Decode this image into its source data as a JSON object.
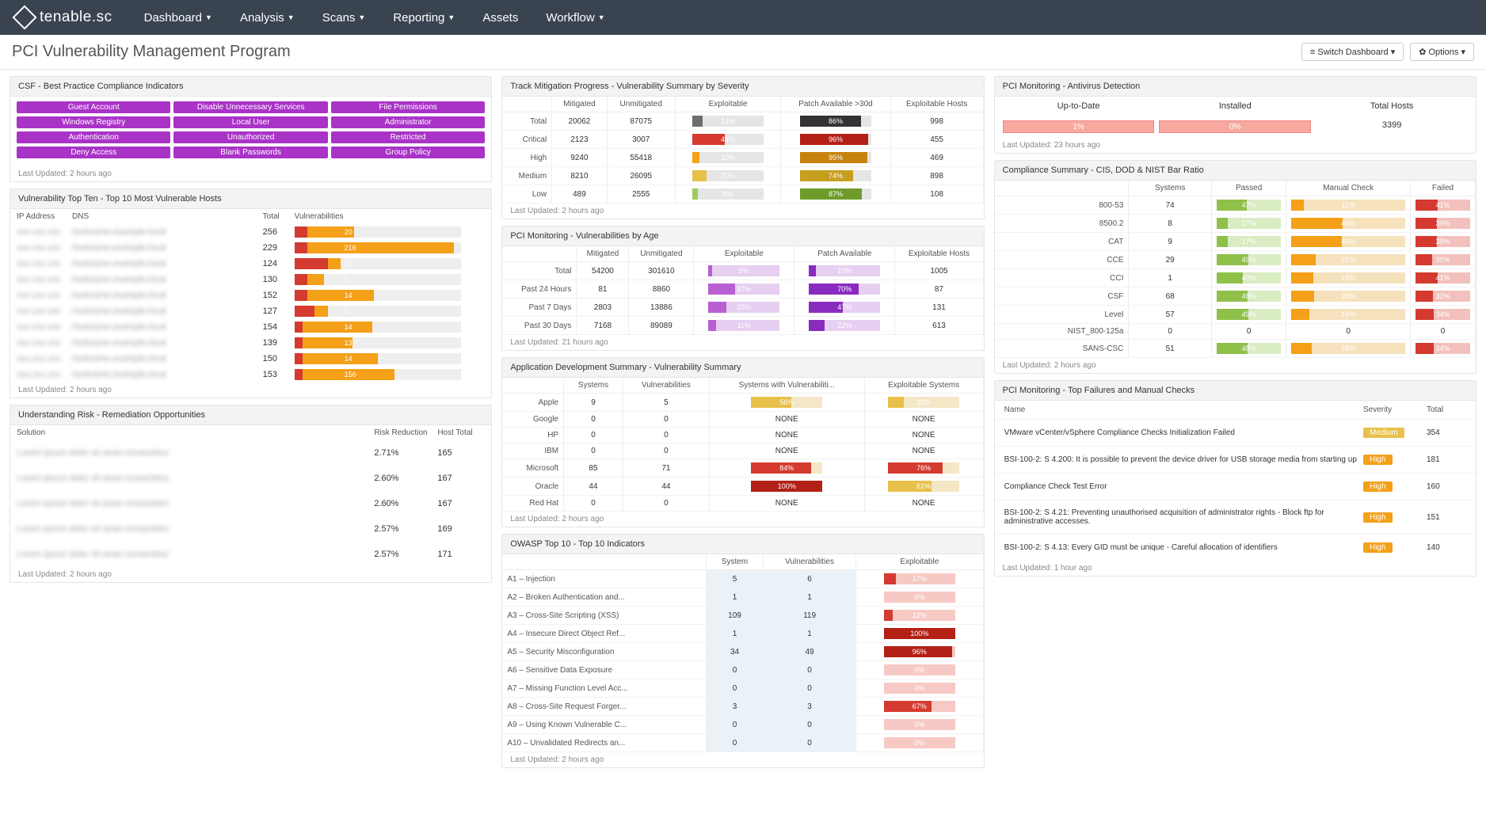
{
  "brand": "tenable.sc",
  "nav": [
    {
      "label": "Dashboard",
      "caret": true
    },
    {
      "label": "Analysis",
      "caret": true
    },
    {
      "label": "Scans",
      "caret": true
    },
    {
      "label": "Reporting",
      "caret": true
    },
    {
      "label": "Assets",
      "caret": false
    },
    {
      "label": "Workflow",
      "caret": true
    }
  ],
  "page_title": "PCI Vulnerability Management Program",
  "header_buttons": {
    "switch": "Switch Dashboard",
    "options": "Options"
  },
  "csf": {
    "title": "CSF - Best Practice Compliance Indicators",
    "rows": [
      [
        "Guest Account",
        "Disable Unnecessary Services",
        "File Permissions"
      ],
      [
        "Windows Registry",
        "Local User",
        "Administrator"
      ],
      [
        "Authentication",
        "Unauthorized",
        "Restricted"
      ],
      [
        "Deny Access",
        "Blank Passwords",
        "Group Policy"
      ]
    ],
    "last_updated": "Last Updated: 2 hours ago"
  },
  "top10": {
    "title": "Vulnerability Top Ten - Top 10 Most Vulnerable Hosts",
    "headers": {
      "ip": "IP Address",
      "dns": "DNS",
      "total": "Total",
      "vuln": "Vulnerabilities"
    },
    "rows": [
      {
        "total": 256,
        "red": 8,
        "or": 28,
        "label": "20"
      },
      {
        "total": 229,
        "red": 8,
        "or": 88,
        "label": "216"
      },
      {
        "total": 124,
        "red": 20,
        "or": 8,
        "label": "24"
      },
      {
        "total": 130,
        "red": 8,
        "or": 10,
        "label": "1"
      },
      {
        "total": 152,
        "red": 8,
        "or": 40,
        "label": "14"
      },
      {
        "total": 127,
        "red": 12,
        "or": 8,
        "label": "1"
      },
      {
        "total": 154,
        "red": 5,
        "or": 42,
        "label": "14"
      },
      {
        "total": 139,
        "red": 5,
        "or": 30,
        "label": "13"
      },
      {
        "total": 150,
        "red": 5,
        "or": 45,
        "label": "14"
      },
      {
        "total": 153,
        "red": 5,
        "or": 55,
        "label": "156"
      }
    ],
    "last_updated": "Last Updated: 2 hours ago"
  },
  "risk": {
    "title": "Understanding Risk - Remediation Opportunities",
    "headers": {
      "sol": "Solution",
      "red": "Risk Reduction",
      "host": "Host Total"
    },
    "rows": [
      {
        "red": "2.71%",
        "host": 165
      },
      {
        "red": "2.60%",
        "host": 167
      },
      {
        "red": "2.60%",
        "host": 167
      },
      {
        "red": "2.57%",
        "host": 169
      },
      {
        "red": "2.57%",
        "host": 171
      }
    ],
    "last_updated": "Last Updated: 2 hours ago"
  },
  "mitigation": {
    "title": "Track Mitigation Progress - Vulnerability Summary by Severity",
    "headers": [
      "",
      "Mitigated",
      "Unmitigated",
      "Exploitable",
      "Patch Available >30d",
      "Exploitable Hosts"
    ],
    "rows": [
      {
        "label": "Total",
        "mit": 20062,
        "unmit": 87075,
        "exp": "14%",
        "expC": "#6d6d6d",
        "patch": "86%",
        "patchC": "#333",
        "hosts": 998
      },
      {
        "label": "Critical",
        "mit": 2123,
        "unmit": 3007,
        "exp": "46%",
        "expC": "#d43a2f",
        "patch": "96%",
        "patchC": "#b32016",
        "hosts": 455
      },
      {
        "label": "High",
        "mit": 9240,
        "unmit": 55418,
        "exp": "10%",
        "expC": "#f4a018",
        "patch": "95%",
        "patchC": "#c7820e",
        "hosts": 469
      },
      {
        "label": "Medium",
        "mit": 8210,
        "unmit": 26095,
        "exp": "20%",
        "expC": "#e8c04a",
        "patch": "74%",
        "patchC": "#c79f1f",
        "hosts": 898
      },
      {
        "label": "Low",
        "mit": 489,
        "unmit": 2555,
        "exp": "8%",
        "expC": "#9fc95c",
        "patch": "87%",
        "patchC": "#6d9c2b",
        "hosts": 108
      }
    ],
    "last_updated": "Last Updated: 2 hours ago"
  },
  "byage": {
    "title": "PCI Monitoring - Vulnerabilities by Age",
    "headers": [
      "",
      "Mitigated",
      "Unmitigated",
      "Exploitable",
      "Patch Available",
      "Exploitable Hosts"
    ],
    "rows": [
      {
        "label": "Total",
        "mit": 54200,
        "unmit": 301610,
        "exp": "5%",
        "patch": "10%",
        "hosts": 1005
      },
      {
        "label": "Past 24 Hours",
        "mit": 81,
        "unmit": 8860,
        "exp": "37%",
        "patch": "70%",
        "hosts": 87
      },
      {
        "label": "Past 7 Days",
        "mit": 2803,
        "unmit": 13886,
        "exp": "25%",
        "patch": "47%",
        "hosts": 131
      },
      {
        "label": "Past 30 Days",
        "mit": 7168,
        "unmit": 89089,
        "exp": "11%",
        "patch": "22%",
        "hosts": 613
      }
    ],
    "last_updated": "Last Updated: 21 hours ago"
  },
  "appdev": {
    "title": "Application Development Summary - Vulnerability Summary",
    "headers": [
      "",
      "Systems",
      "Vulnerabilities",
      "Systems with Vulnerabiliti...",
      "Exploitable Systems"
    ],
    "rows": [
      {
        "label": "Apple",
        "sys": 9,
        "vuln": 5,
        "swv": "56%",
        "swvC": "#e8c04a",
        "es": "22%",
        "esC": "#e8c04a"
      },
      {
        "label": "Google",
        "sys": 0,
        "vuln": 0,
        "swv": "NONE",
        "swvC": "",
        "es": "NONE",
        "esC": ""
      },
      {
        "label": "HP",
        "sys": 0,
        "vuln": 0,
        "swv": "NONE",
        "swvC": "",
        "es": "NONE",
        "esC": ""
      },
      {
        "label": "IBM",
        "sys": 0,
        "vuln": 0,
        "swv": "NONE",
        "swvC": "",
        "es": "NONE",
        "esC": ""
      },
      {
        "label": "Microsoft",
        "sys": 85,
        "vuln": 71,
        "swv": "84%",
        "swvC": "#d43a2f",
        "es": "76%",
        "esC": "#d43a2f"
      },
      {
        "label": "Oracle",
        "sys": 44,
        "vuln": 44,
        "swv": "100%",
        "swvC": "#b32016",
        "es": "61%",
        "esC": "#e8c04a"
      },
      {
        "label": "Red Hat",
        "sys": 0,
        "vuln": 0,
        "swv": "NONE",
        "swvC": "",
        "es": "NONE",
        "esC": ""
      }
    ],
    "last_updated": "Last Updated: 2 hours ago"
  },
  "owasp": {
    "title": "OWASP Top 10 - Top 10 Indicators",
    "headers": [
      "",
      "System",
      "Vulnerabilities",
      "Exploitable"
    ],
    "rows": [
      {
        "label": "A1 – Injection",
        "sys": 5,
        "vuln": 6,
        "exp": "17%",
        "c": "#d43a2f"
      },
      {
        "label": "A2 – Broken Authentication and...",
        "sys": 1,
        "vuln": 1,
        "exp": "0%",
        "c": "#f2a6a0"
      },
      {
        "label": "A3 – Cross-Site Scripting (XSS)",
        "sys": 109,
        "vuln": 119,
        "exp": "12%",
        "c": "#d43a2f"
      },
      {
        "label": "A4 – Insecure Direct Object Ref...",
        "sys": 1,
        "vuln": 1,
        "exp": "100%",
        "c": "#b32016"
      },
      {
        "label": "A5 – Security Misconfiguration",
        "sys": 34,
        "vuln": 49,
        "exp": "96%",
        "c": "#b32016"
      },
      {
        "label": "A6 – Sensitive Data Exposure",
        "sys": 0,
        "vuln": 0,
        "exp": "0%",
        "c": "#f2a6a0"
      },
      {
        "label": "A7 – Missing Function Level Acc...",
        "sys": 0,
        "vuln": 0,
        "exp": "0%",
        "c": "#f2a6a0"
      },
      {
        "label": "A8 – Cross-Site Request Forger...",
        "sys": 3,
        "vuln": 3,
        "exp": "67%",
        "c": "#d43a2f"
      },
      {
        "label": "A9 – Using Known Vulnerable C...",
        "sys": 0,
        "vuln": 0,
        "exp": "0%",
        "c": "#f2a6a0"
      },
      {
        "label": "A10 – Unvalidated Redirects an...",
        "sys": 0,
        "vuln": 0,
        "exp": "0%",
        "c": "#f2a6a0"
      }
    ],
    "last_updated": "Last Updated: 2 hours ago"
  },
  "antivirus": {
    "title": "PCI Monitoring - Antivirus Detection",
    "headers": [
      "Up-to-Date",
      "Installed",
      "Total Hosts"
    ],
    "up": "1%",
    "inst": "0%",
    "total": "3399",
    "last_updated": "Last Updated: 23 hours ago"
  },
  "compliance": {
    "title": "Compliance Summary - CIS, DOD & NIST Bar Ratio",
    "headers": [
      "",
      "Systems",
      "Passed",
      "Manual Check",
      "Failed"
    ],
    "rows": [
      {
        "label": "800-53",
        "sys": 74,
        "p": "47%",
        "m": "11%",
        "f": "41%"
      },
      {
        "label": "8500.2",
        "sys": 8,
        "p": "17%",
        "m": "45%",
        "f": "39%"
      },
      {
        "label": "CAT",
        "sys": 9,
        "p": "17%",
        "m": "44%",
        "f": "39%"
      },
      {
        "label": "CCE",
        "sys": 29,
        "p": "49%",
        "m": "21%",
        "f": "30%"
      },
      {
        "label": "CCI",
        "sys": 1,
        "p": "40%",
        "m": "19%",
        "f": "41%"
      },
      {
        "label": "CSF",
        "sys": 68,
        "p": "48%",
        "m": "20%",
        "f": "32%"
      },
      {
        "label": "Level",
        "sys": 57,
        "p": "49%",
        "m": "16%",
        "f": "34%"
      },
      {
        "label": "NIST_800-125a",
        "sys": 0,
        "p": "0",
        "m": "0",
        "f": "0"
      },
      {
        "label": "SANS-CSC",
        "sys": 51,
        "p": "48%",
        "m": "18%",
        "f": "34%"
      }
    ],
    "last_updated": "Last Updated: 2 hours ago"
  },
  "failures": {
    "title": "PCI Monitoring - Top Failures and Manual Checks",
    "headers": {
      "name": "Name",
      "sev": "Severity",
      "total": "Total"
    },
    "rows": [
      {
        "name": "VMware vCenter/vSphere Compliance Checks Initialization Failed",
        "sev": "Medium",
        "total": 354
      },
      {
        "name": "BSI-100-2: S 4.200: It is possible to prevent the device driver for USB storage media from starting up",
        "sev": "High",
        "total": 181
      },
      {
        "name": "Compliance Check Test Error",
        "sev": "High",
        "total": 160
      },
      {
        "name": "BSI-100-2: S 4.21: Preventing unauthorised acquisition of administrator rights - Block ftp for administrative accesses.",
        "sev": "High",
        "total": 151
      },
      {
        "name": "BSI-100-2: S 4.13: Every GID must be unique - Careful allocation of identifiers",
        "sev": "High",
        "total": 140
      }
    ],
    "last_updated": "Last Updated: 1 hour ago"
  }
}
